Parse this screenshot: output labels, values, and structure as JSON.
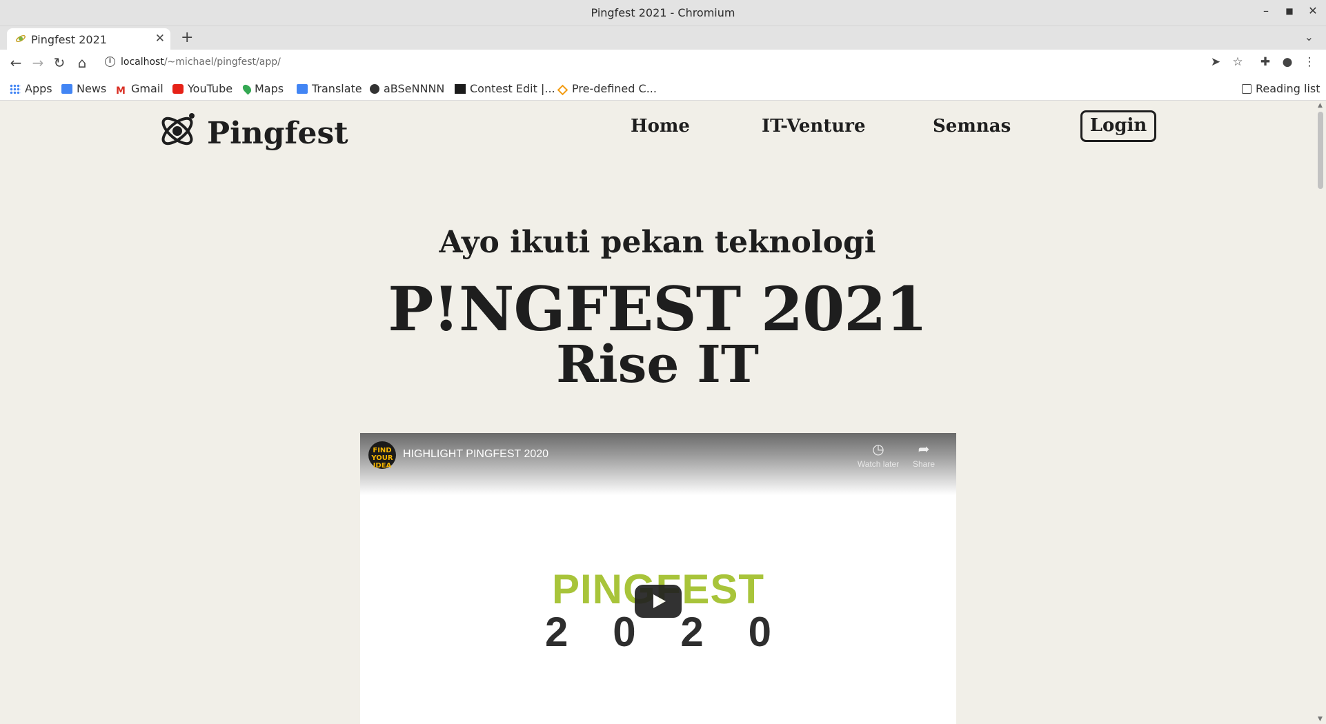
{
  "window": {
    "title": "Pingfest 2021 - Chromium"
  },
  "tabs": [
    {
      "label": "Pingfest 2021"
    }
  ],
  "omnibox": {
    "host": "localhost",
    "path": "/~michael/pingfest/app/"
  },
  "bookmarks": [
    {
      "label": "Apps",
      "icon": "apps-grid-icon"
    },
    {
      "label": "News",
      "icon": "google-news-icon"
    },
    {
      "label": "Gmail",
      "icon": "gmail-icon"
    },
    {
      "label": "YouTube",
      "icon": "youtube-icon"
    },
    {
      "label": "Maps",
      "icon": "maps-pin-icon"
    },
    {
      "label": "Translate",
      "icon": "translate-icon"
    },
    {
      "label": "aBSeNNNN",
      "icon": "globe-icon"
    },
    {
      "label": "Contest Edit |...",
      "icon": "hackerrank-icon"
    },
    {
      "label": "Pre-defined C...",
      "icon": "diamond-icon"
    }
  ],
  "reading_list": "Reading list",
  "site": {
    "brand": "Pingfest",
    "nav": [
      "Home",
      "IT-Venture",
      "Semnas"
    ],
    "login": "Login",
    "hero": {
      "subtitle": "Ayo ikuti pekan teknologi",
      "title": "P!NGFEST 2021",
      "tagline": "Rise IT"
    },
    "video": {
      "title": "HIGHLIGHT PINGFEST 2020",
      "channel_badge": "FIND YOUR IDEA",
      "watch_later": "Watch later",
      "share": "Share",
      "thumb_word": "PINGFEST",
      "thumb_year": [
        "2",
        "0",
        "2",
        "0"
      ]
    }
  },
  "colors": {
    "page_bg": "#f1efe8",
    "text": "#1e1e1e",
    "accent_green": "#a8c43a"
  }
}
